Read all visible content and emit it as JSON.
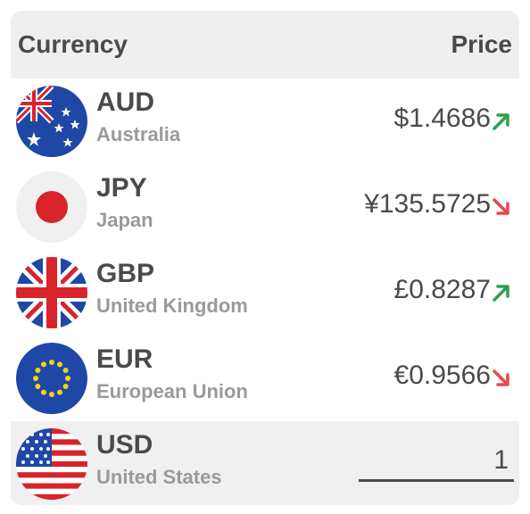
{
  "header": {
    "currency_label": "Currency",
    "price_label": "Price"
  },
  "rows": [
    {
      "code": "AUD",
      "country": "Australia",
      "price": "$1.4686",
      "trend": "up"
    },
    {
      "code": "JPY",
      "country": "Japan",
      "price": "¥135.5725",
      "trend": "down"
    },
    {
      "code": "GBP",
      "country": "United Kingdom",
      "price": "£0.8287",
      "trend": "up"
    },
    {
      "code": "EUR",
      "country": "European Union",
      "price": "€0.9566",
      "trend": "down"
    }
  ],
  "base": {
    "code": "USD",
    "country": "United States",
    "amount": "1"
  },
  "colors": {
    "up": "#2e9e4f",
    "down": "#e5484d",
    "text": "#4a4a4a",
    "subtext": "#9a9a9a"
  }
}
